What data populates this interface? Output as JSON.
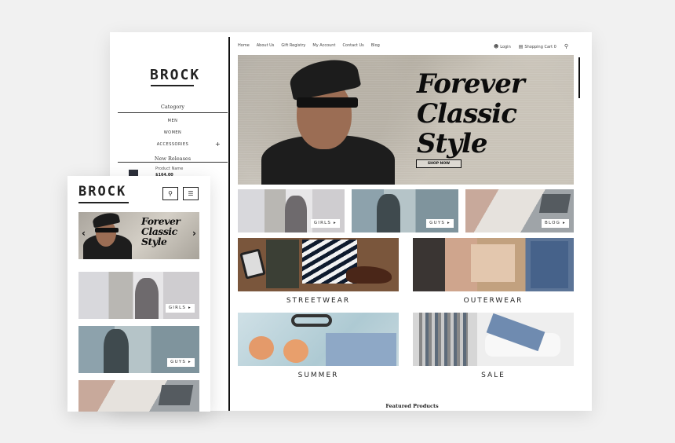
{
  "desktop": {
    "logo": "BROCK",
    "sidebar": {
      "category_title": "Category",
      "categories": [
        "MEN",
        "WOMEN",
        "ACCESSORIES"
      ],
      "accessories_toggle": "+",
      "new_releases_title": "New Releases",
      "product_name": "Product Name",
      "product_price": "$164.00"
    },
    "nav": {
      "links": [
        "Home",
        "About Us",
        "Gift Registry",
        "My Account",
        "Contact Us",
        "Blog"
      ],
      "login": "Login",
      "cart": "Shopping Cart",
      "cart_count": "0"
    },
    "hero": {
      "line1": "Forever",
      "line2": "Classic",
      "line3": "Style",
      "button": "SHOP NOW"
    },
    "tiles": {
      "girls": "GIRLS",
      "guys": "GUYS",
      "blog": "BLOG",
      "arrow": "▸"
    },
    "grid": {
      "streetwear": "STREETWEAR",
      "outerwear": "OUTERWEAR",
      "summer": "SUMMER",
      "sale": "SALE"
    },
    "featured_title": "Featured Products"
  },
  "mobile": {
    "logo": "BROCK",
    "hero": {
      "line1": "Forever",
      "line2": "Classic",
      "line3": "Style"
    },
    "tiles": {
      "girls": "GIRLS",
      "guys": "GUYS",
      "arrow": "▸"
    }
  },
  "icons": {
    "search": "⌕",
    "menu": "☰",
    "user": "👤",
    "cart": "🛒",
    "prev": "‹",
    "next": "›"
  },
  "colors": {
    "background": "#f1f1f1",
    "frame": "#ffffff",
    "ink": "#111111"
  }
}
